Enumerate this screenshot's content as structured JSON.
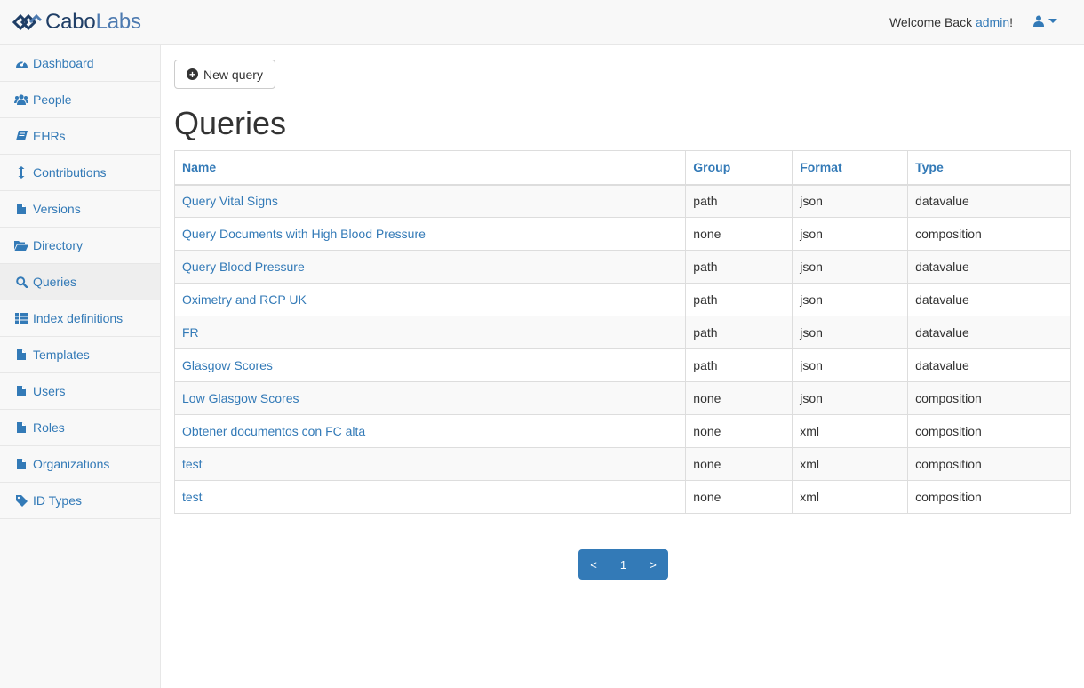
{
  "brand": {
    "part1": "Cabo",
    "part2": "Labs"
  },
  "header": {
    "welcome_prefix": "Welcome Back ",
    "username": "admin",
    "welcome_suffix": "!"
  },
  "sidebar": {
    "items": [
      {
        "label": "Dashboard",
        "icon": "dashboard-icon"
      },
      {
        "label": "People",
        "icon": "users-icon"
      },
      {
        "label": "EHRs",
        "icon": "book-icon"
      },
      {
        "label": "Contributions",
        "icon": "vertical-arrows-icon"
      },
      {
        "label": "Versions",
        "icon": "file-icon"
      },
      {
        "label": "Directory",
        "icon": "folder-open-icon"
      },
      {
        "label": "Queries",
        "icon": "search-icon"
      },
      {
        "label": "Index definitions",
        "icon": "table-icon"
      },
      {
        "label": "Templates",
        "icon": "file-icon"
      },
      {
        "label": "Users",
        "icon": "file-icon"
      },
      {
        "label": "Roles",
        "icon": "file-icon"
      },
      {
        "label": "Organizations",
        "icon": "file-icon"
      },
      {
        "label": "ID Types",
        "icon": "tag-icon"
      }
    ],
    "active": "Queries"
  },
  "main": {
    "new_query_label": "New query",
    "title": "Queries",
    "table": {
      "headers": [
        "Name",
        "Group",
        "Format",
        "Type"
      ],
      "rows": [
        [
          "Query Vital Signs",
          "path",
          "json",
          "datavalue"
        ],
        [
          "Query Documents with High Blood Pressure",
          "none",
          "json",
          "composition"
        ],
        [
          "Query Blood Pressure",
          "path",
          "json",
          "datavalue"
        ],
        [
          "Oximetry and RCP UK",
          "path",
          "json",
          "datavalue"
        ],
        [
          "FR",
          "path",
          "json",
          "datavalue"
        ],
        [
          "Glasgow Scores",
          "path",
          "json",
          "datavalue"
        ],
        [
          "Low Glasgow Scores",
          "none",
          "json",
          "composition"
        ],
        [
          "Obtener documentos con FC alta",
          "none",
          "xml",
          "composition"
        ],
        [
          "test",
          "none",
          "xml",
          "composition"
        ],
        [
          "test",
          "none",
          "xml",
          "composition"
        ]
      ]
    },
    "pagination": {
      "prev": "<",
      "page": "1",
      "next": ">"
    }
  },
  "colors": {
    "link": "#337ab7",
    "brand_dark": "#1f3e66",
    "brand_light": "#4d7ab0",
    "pagination_bg": "#337ab7"
  }
}
